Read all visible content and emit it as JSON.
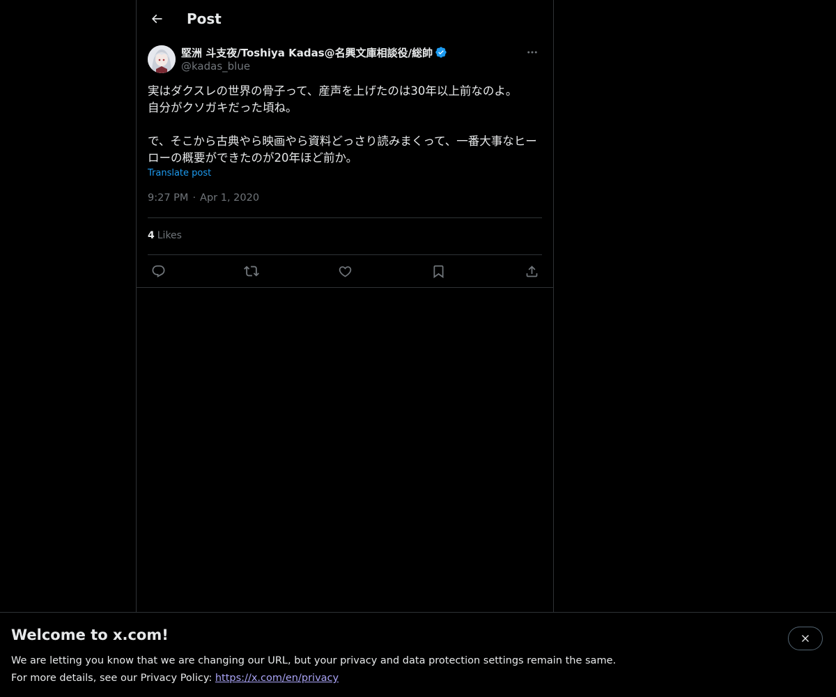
{
  "header": {
    "title": "Post"
  },
  "post": {
    "display_name": "堅洲 斗支夜/Toshiya Kadas@名興文庫相談役/総帥",
    "handle": "@kadas_blue",
    "text": "実はダクスレの世界の骨子って、産声を上げたのは30年以上前なのよ。\n自分がクソガキだった頃ね。\n\nで、そこから古典やら映画やら資料どっさり読みまくって、一番大事なヒーローの概要ができたのが20年ほど前か。",
    "translate_label": "Translate post",
    "time": "9:27 PM",
    "separator": "·",
    "date": "Apr 1, 2020",
    "likes_count": "4",
    "likes_label": "Likes"
  },
  "icons": {
    "back": "arrow-left-icon",
    "more": "more-horizontal-icon",
    "verified": "verified-badge-icon",
    "reply": "reply-icon",
    "repost": "repost-icon",
    "like": "heart-icon",
    "bookmark": "bookmark-icon",
    "share": "share-icon",
    "close": "close-icon"
  },
  "colors": {
    "background": "#000000",
    "text": "#e7e9ea",
    "muted": "#71767b",
    "accent": "#1d9bf0",
    "border": "#2f3336",
    "link": "#a9a3f5"
  },
  "banner": {
    "title": "Welcome to x.com!",
    "line1": "We are letting you know that we are changing our URL, but your privacy and data protection settings remain the same.",
    "line2_prefix": "For more details, see our Privacy Policy: ",
    "link_text": "https://x.com/en/privacy"
  }
}
